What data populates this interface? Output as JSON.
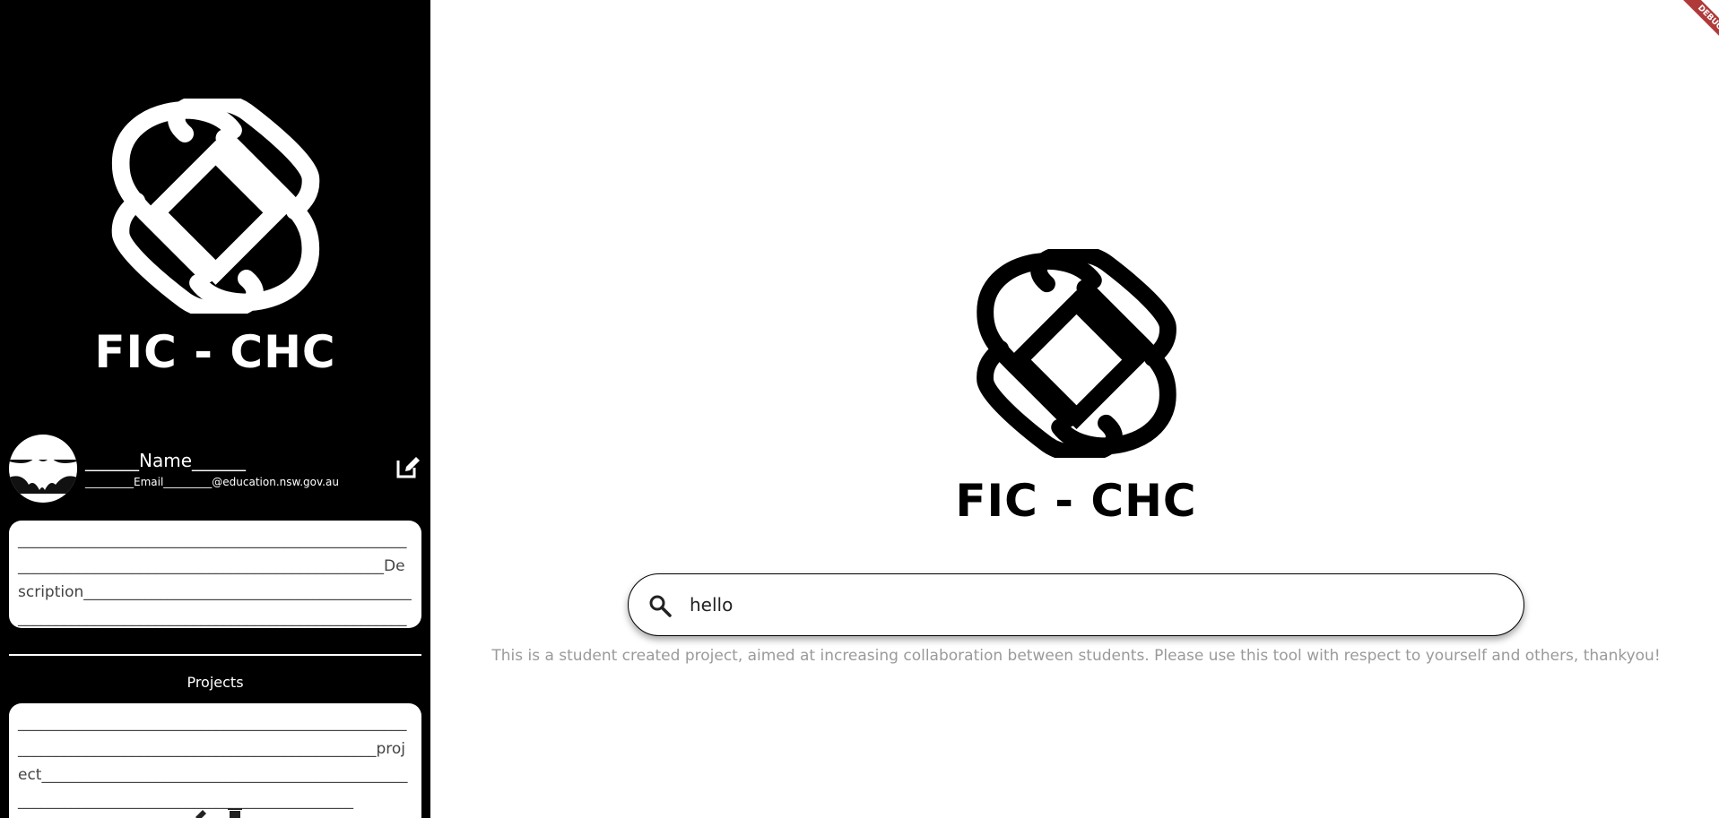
{
  "sidebar": {
    "logo_text": "FIC - CHC",
    "profile": {
      "name": "______Name______",
      "email": "_________Email_________@education.nsw.gov.au"
    },
    "description": "___________________________________________________________________________________________________Description______________________________________________________________________________________________",
    "projects_title": "Projects",
    "project_text": "__________________________________________________________________________________________________project____________________________________________________________________________________________"
  },
  "main": {
    "logo_text": "FIC - CHC",
    "search": {
      "value": "hello"
    },
    "disclaimer": "This is a student created project, aimed at increasing collaboration between students. Please use this tool with respect to yourself and others, thankyou!"
  },
  "debug_banner": "DEBUG",
  "colors": {
    "sidebar_bg": "#000000",
    "main_bg": "#ffffff",
    "disclaimer_text": "#9a9a9a",
    "debug_banner": "#b03a3a"
  },
  "icons": [
    "fic-chc-logo",
    "avatar-bat-icon",
    "edit-icon",
    "search-icon",
    "pin-icon",
    "delete-icon"
  ]
}
